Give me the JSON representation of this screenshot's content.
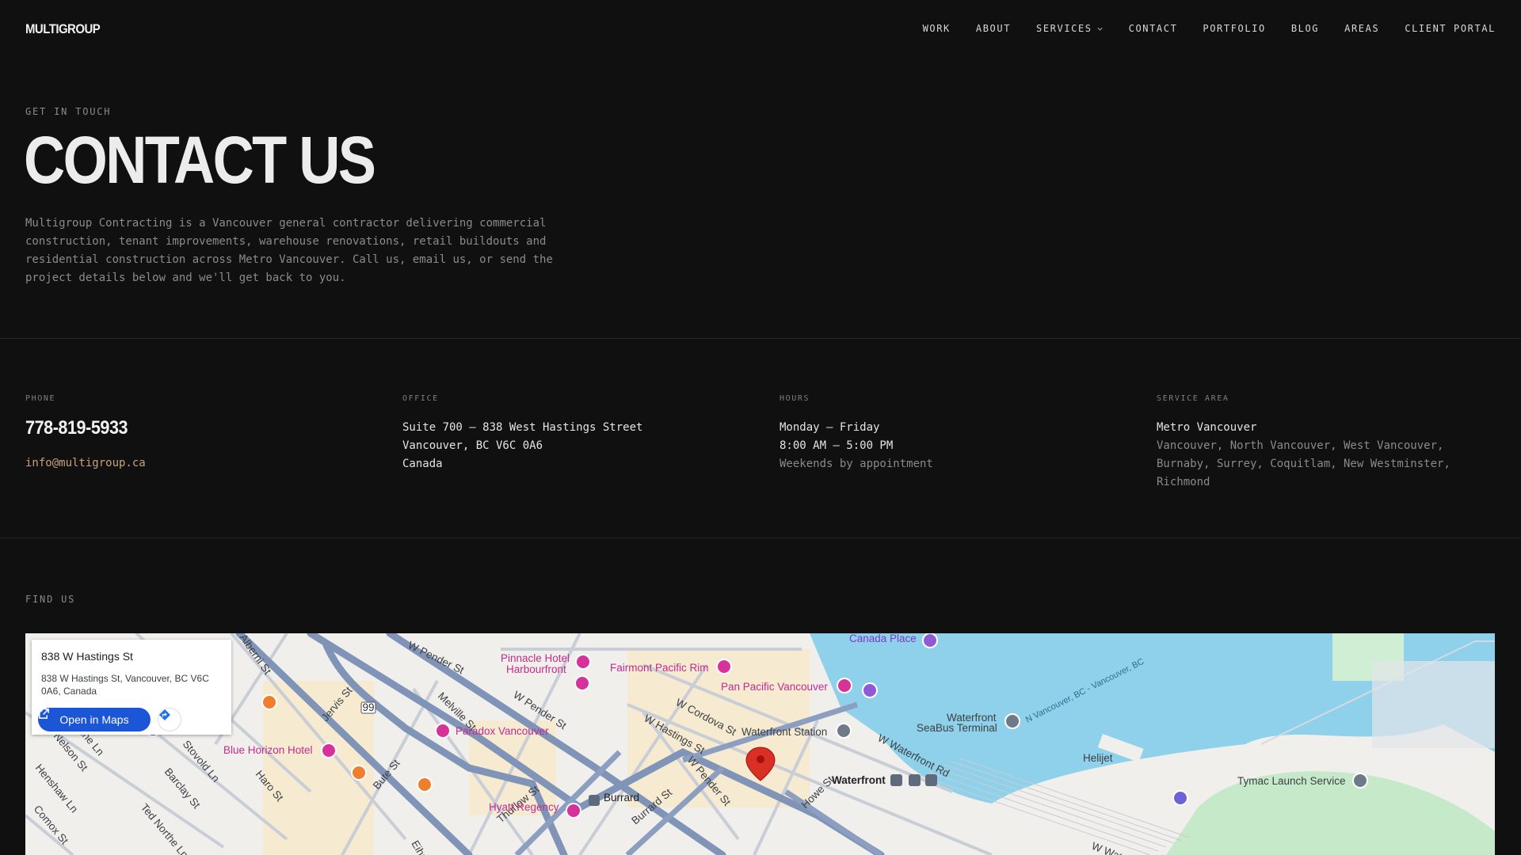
{
  "brand": {
    "logo": "MULTIGROUP"
  },
  "nav": {
    "items": [
      {
        "label": "WORK"
      },
      {
        "label": "ABOUT"
      },
      {
        "label": "SERVICES"
      },
      {
        "label": "CONTACT"
      },
      {
        "label": "PORTFOLIO"
      },
      {
        "label": "BLOG"
      },
      {
        "label": "AREAS"
      },
      {
        "label": "CLIENT PORTAL"
      }
    ]
  },
  "hero": {
    "eyebrow": "GET IN TOUCH",
    "title": "CONTACT US",
    "description": "Multigroup Contracting is a Vancouver general contractor delivering commercial construction, tenant improvements, warehouse renovations, retail buildouts and residential construction across Metro Vancouver. Call us, email us, or send the project details below and we'll get back to you."
  },
  "info": {
    "phone": {
      "label": "PHONE",
      "number": "778-819-5933",
      "email": "info@multigroup.ca"
    },
    "office": {
      "label": "OFFICE",
      "lines": [
        "Suite 700 – 838 West Hastings Street",
        "Vancouver, BC V6C 0A6",
        "Canada"
      ]
    },
    "hours": {
      "label": "HOURS",
      "days": "Monday – Friday",
      "time": "8:00 AM – 5:00 PM",
      "note": "Weekends by appointment"
    },
    "service_area": {
      "label": "SERVICE AREA",
      "title": "Metro Vancouver",
      "areas": "Vancouver, North Vancouver, West Vancouver, Burnaby, Surrey, Coquitlam, New Westminster, Richmond"
    }
  },
  "find_us": {
    "label": "FIND US",
    "card": {
      "title": "838 W Hastings St",
      "address": "838 W Hastings St, Vancouver, BC V6C 0A6, Canada",
      "open_label": "Open in Maps"
    },
    "places": {
      "canada_place": "Canada Place",
      "pinnacle": "Pinnacle Hotel",
      "pinnacle2": "Harbourfront",
      "fairmont": "Fairmont Pacific Rim",
      "pan_pacific": "Pan Pacific Vancouver",
      "paradox": "Paradox Vancouver",
      "blue_horizon": "Blue Horizon Hotel",
      "waterfront_station": "Waterfront Station",
      "waterfront_seabus": "Waterfront",
      "waterfront_seabus2": "SeaBus Terminal",
      "waterfront": "Waterfront",
      "helijet": "Helijet",
      "tymac": "Tymac Launch Service",
      "burrard": "Burrard",
      "hyatt": "Hyatt Regency"
    },
    "streets": {
      "w_pender_1": "W Pender St",
      "w_pender_2": "W Pender St",
      "w_pender_3": "W Pender St",
      "melville": "Melville St",
      "w_cordova": "W Cordova St",
      "w_hastings": "W Hastings St",
      "howe": "Howe St",
      "w_waterfront": "W Waterfront Rd",
      "seabus_route": "N Vancouver, BC - Vancouver, BC",
      "thurlow": "Thurlow St",
      "burrard_st": "Burrard St",
      "jervis": "Jervis St",
      "bute": "Bute St",
      "haro": "Haro St",
      "barclay": "Barclay St",
      "stovold": "Stovold Ln",
      "nelson": "Nelson St",
      "henshaw": "Henshaw Ln",
      "comox": "Comox St",
      "ted_north": "Ted Northe Ln",
      "northe": "Northe Ln",
      "hwy": "99",
      "alberni": "Alberni St",
      "eihu": "Eihu",
      "w_water": "W Wate"
    }
  }
}
